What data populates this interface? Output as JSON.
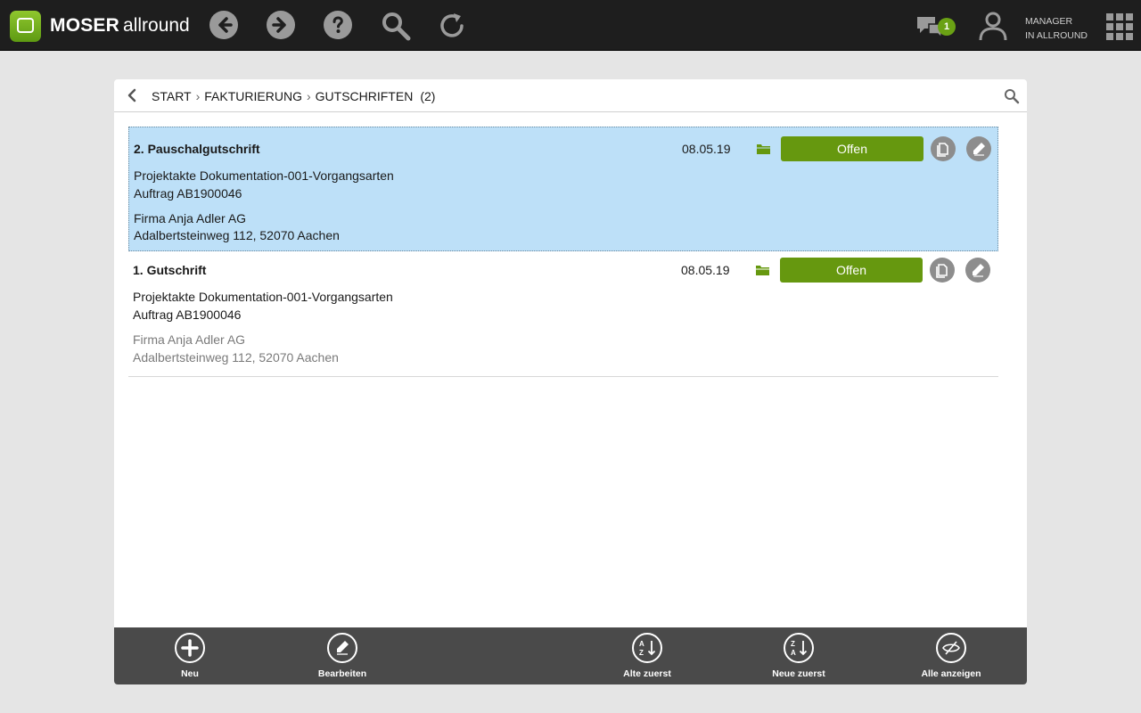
{
  "brand": {
    "name_bold": "MOSER",
    "name_light": "allround"
  },
  "topbar": {
    "chat_badge": "1",
    "user_line1": "MANAGER",
    "user_line2": "IN ALLROUND"
  },
  "breadcrumb": {
    "items": [
      "START",
      "FAKTURIERUNG",
      "GUTSCHRIFTEN"
    ],
    "count": "(2)"
  },
  "list": {
    "items": [
      {
        "title": "2. Pauschalgutschrift",
        "date": "08.05.19",
        "status": "Offen",
        "project": "Projektakte Dokumentation-001-Vorgangsarten",
        "order": "Auftrag AB1900046",
        "company": "Firma Anja Adler AG",
        "address": "Adalbertsteinweg 112, 52070 Aachen"
      },
      {
        "title": "1. Gutschrift",
        "date": "08.05.19",
        "status": "Offen",
        "project": "Projektakte Dokumentation-001-Vorgangsarten",
        "order": "Auftrag AB1900046",
        "company": "Firma Anja Adler AG",
        "address": "Adalbertsteinweg 112, 52070 Aachen"
      }
    ]
  },
  "bottombar": {
    "new_label": "Neu",
    "edit_label": "Bearbeiten",
    "oldest_label": "Alte zuerst",
    "newest_label": "Neue zuerst",
    "show_all_label": "Alle anzeigen"
  },
  "colors": {
    "accent_green": "#66980f",
    "selected_row": "#bde0f8",
    "topbar": "#1e1e1e",
    "bottombar": "#4a4a4a"
  },
  "icons": {
    "topbar": [
      "back-icon",
      "forward-icon",
      "help-icon",
      "search-icon",
      "refresh-icon",
      "chat-icon",
      "user-icon",
      "apps-grid-icon"
    ],
    "row": [
      "folder-icon",
      "copy-icon",
      "edit-icon"
    ],
    "bottombar": [
      "plus-icon",
      "edit-icon",
      "sort-az-icon",
      "sort-za-icon",
      "eye-off-icon"
    ]
  }
}
